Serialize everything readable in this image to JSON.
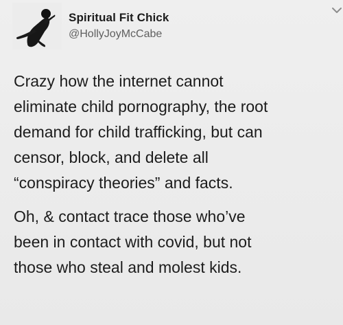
{
  "tweet": {
    "author": {
      "display_name": "Spiritual Fit Chick",
      "handle": "@HollyJoyMcCabe"
    },
    "body_lines": [
      "Crazy how the internet cannot",
      "eliminate child pornography, the root",
      "demand for child trafficking, but can",
      "censor, block, and delete all",
      "“conspiracy theories” and facts.",
      "Oh, & contact trace those who’ve",
      "been in contact with covid, but not",
      "those who steal and molest kids."
    ]
  },
  "icons": {
    "avatar": "avatar-icon",
    "menu": "chevron-down-icon"
  },
  "colors": {
    "background": "#ececec",
    "text": "#1c1c1c",
    "secondary_text": "#5f5f5f"
  }
}
